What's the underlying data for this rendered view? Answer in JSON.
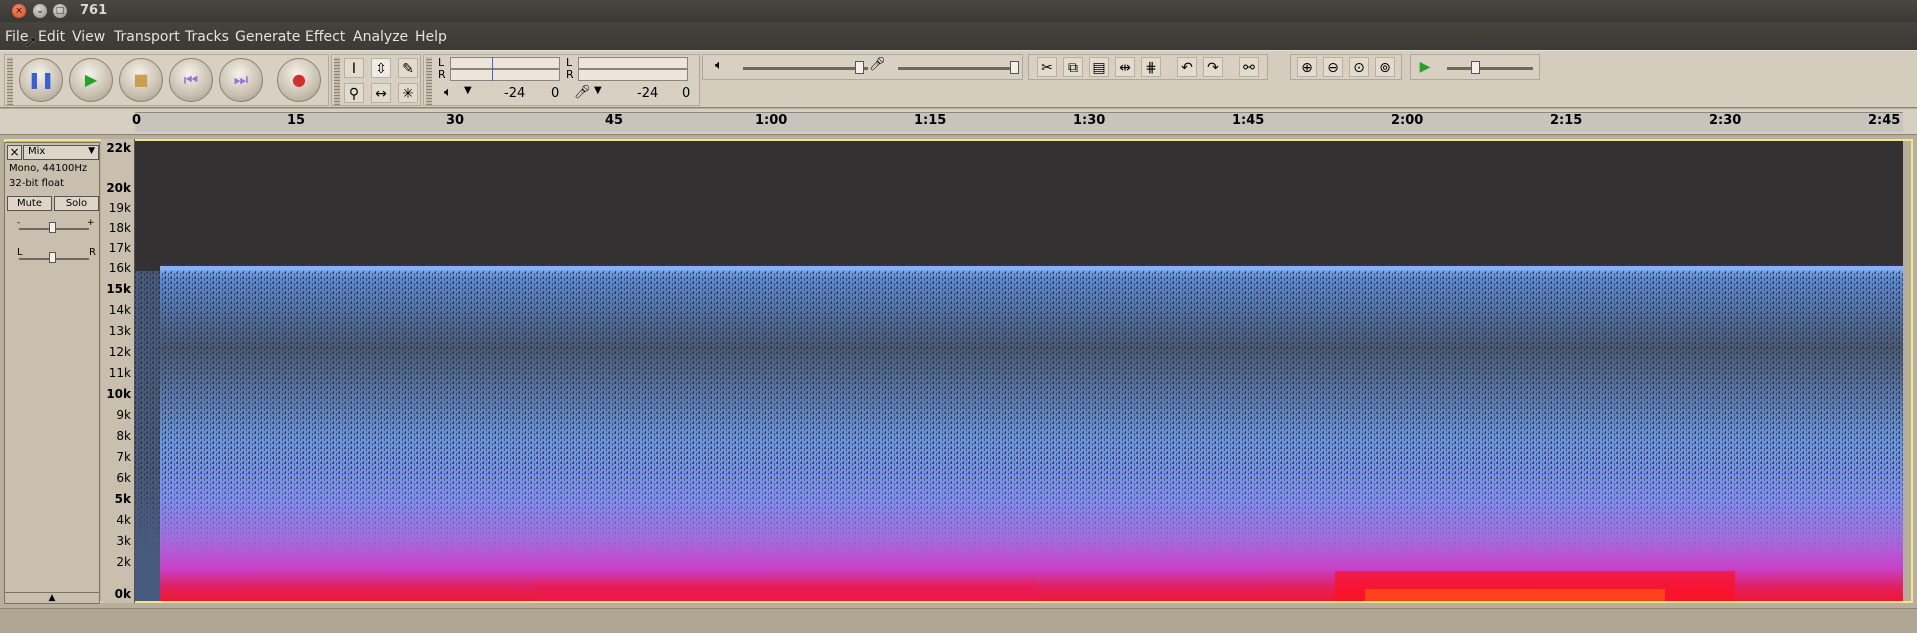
{
  "window": {
    "title": "761"
  },
  "menu": [
    "File",
    "Edit",
    "View",
    "Transport",
    "Tracks",
    "Generate",
    "Effect",
    "Analyze",
    "Help"
  ],
  "meters": {
    "playback_db": "-24",
    "playback_zero": "0",
    "record_db": "-24",
    "record_zero": "0",
    "L": "L",
    "R": "R"
  },
  "ruler": {
    "ticks": [
      "0",
      "15",
      "30",
      "45",
      "1:00",
      "1:15",
      "1:30",
      "1:45",
      "2:00",
      "2:15",
      "2:30",
      "2:45"
    ]
  },
  "track": {
    "name": "Mix",
    "format": "Mono, 44100Hz",
    "bitdepth": "32-bit float",
    "mute": "Mute",
    "solo": "Solo",
    "gain_minus": "-",
    "gain_plus": "+",
    "pan_left": "L",
    "pan_right": "R"
  },
  "freq_axis": [
    "22k",
    "20k",
    "19k",
    "18k",
    "17k",
    "16k",
    "15k",
    "14k",
    "13k",
    "12k",
    "11k",
    "10k",
    "9k",
    "8k",
    "7k",
    "6k",
    "5k",
    "4k",
    "3k",
    "2k",
    "0k"
  ],
  "colors": {
    "spectro_bg": "#333131",
    "high": "#6a9fe8",
    "mid": "#c060e0",
    "low": "#e03070",
    "peak": "#ff1a1a"
  }
}
